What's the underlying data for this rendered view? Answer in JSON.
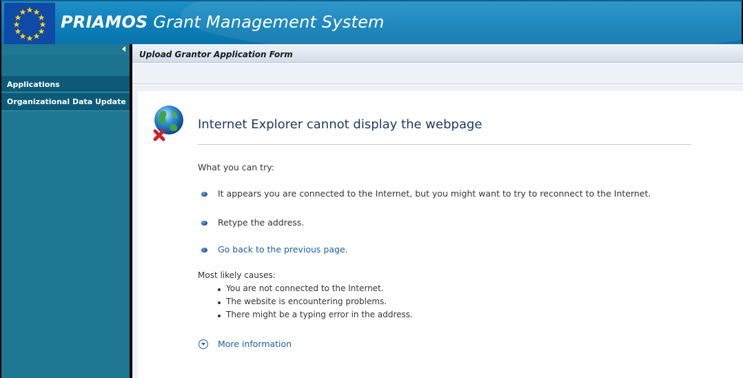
{
  "header": {
    "title_prefix": "PRIAMOS",
    "title_rest": " Grant Management System"
  },
  "sidebar": {
    "items": [
      {
        "label": "Applications"
      },
      {
        "label": "Organizational Data Update"
      }
    ]
  },
  "content": {
    "title": "Upload Grantor Application Form"
  },
  "error_page": {
    "heading": "Internet Explorer cannot display the webpage",
    "try_label": "What you can try:",
    "try_items": [
      "It appears you are connected to the Internet, but you might want to try to reconnect to the Internet.",
      "Retype the address.",
      "Go back to the previous page."
    ],
    "causes_label": "Most likely causes:",
    "causes": [
      "You are not connected to the Internet.",
      "The website is encountering problems.",
      "There might be a typing error in the address."
    ],
    "more_info": "More information"
  },
  "colors": {
    "header_blue": "#0d7fb9",
    "sidebar_teal": "#1f7893",
    "link_blue": "#1a5eab",
    "heading_navy": "#1f3a63"
  },
  "icons": [
    "eu-flag-icon",
    "collapse-arrow-icon",
    "globe-error-icon",
    "bullet-icon",
    "expand-circle-icon"
  ]
}
